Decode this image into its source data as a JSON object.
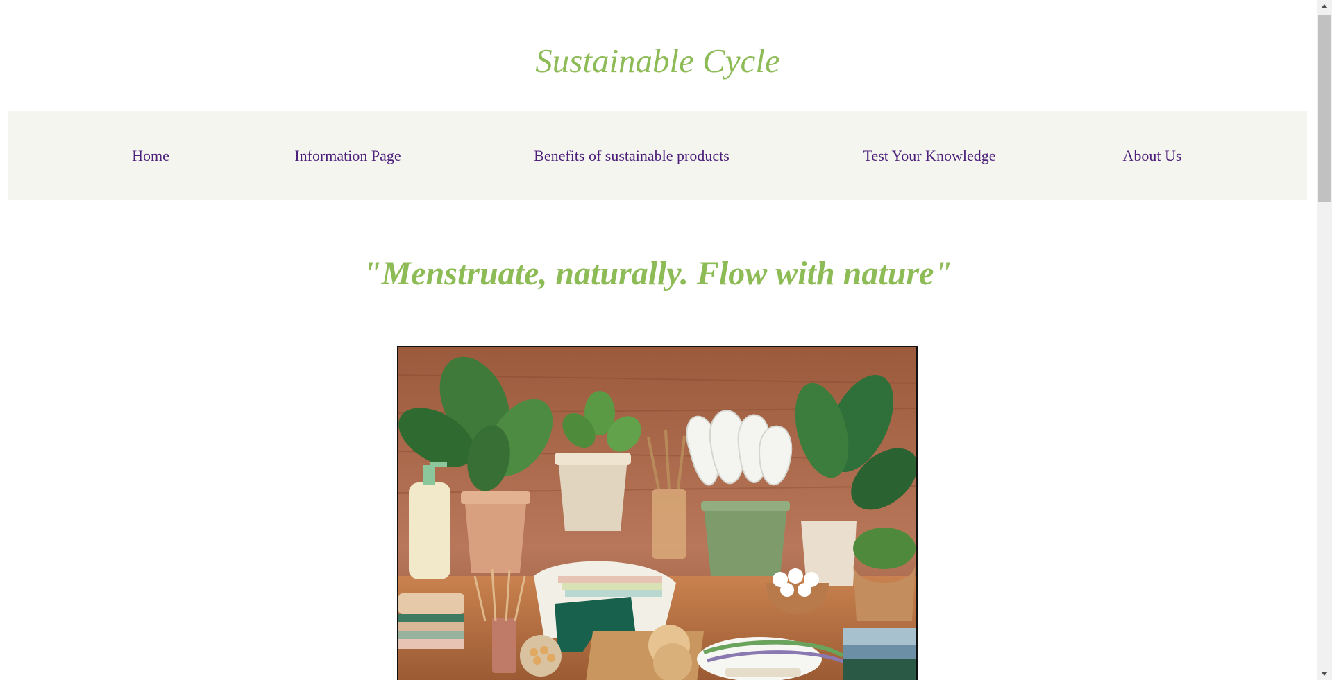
{
  "header": {
    "site_title": "Sustainable Cycle"
  },
  "nav": {
    "items": [
      {
        "label": "Home"
      },
      {
        "label": "Information Page"
      },
      {
        "label": "Benefits of sustainable products"
      },
      {
        "label": "Test Your Knowledge"
      },
      {
        "label": "About Us"
      }
    ]
  },
  "main": {
    "tagline": "\"Menstruate, naturally. Flow with nature\""
  },
  "colors": {
    "title_green": "#8dbb56",
    "nav_link_purple": "#4b1f7a",
    "nav_background": "#f5f5f0"
  }
}
